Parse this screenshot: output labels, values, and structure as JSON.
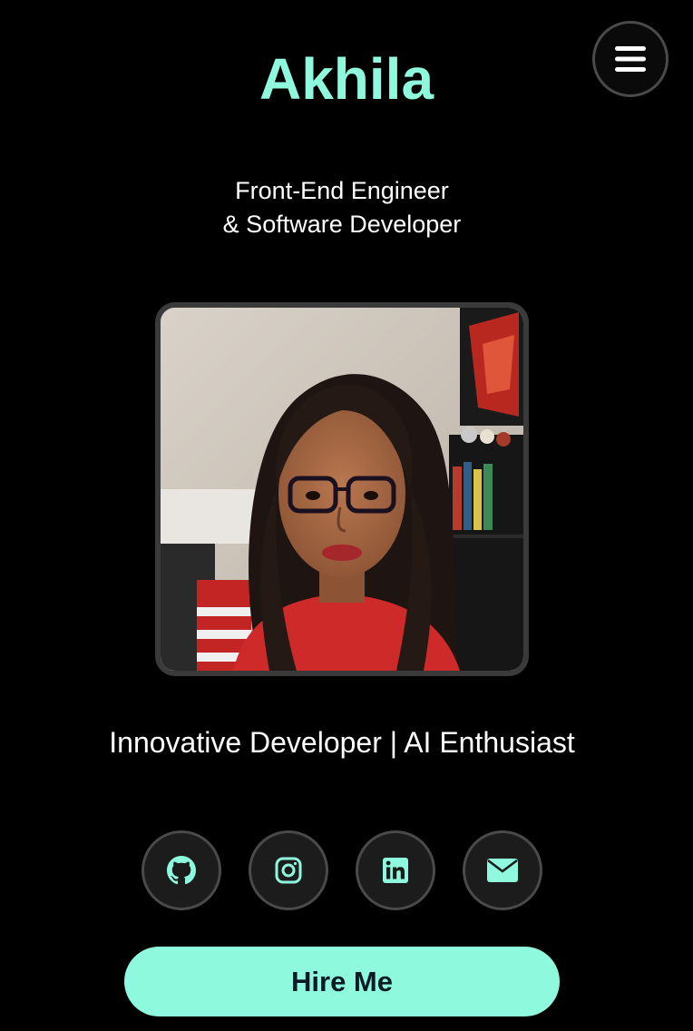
{
  "theme": {
    "accent": "#8ef9dc",
    "background": "#000000",
    "text": "#ffffff",
    "icon_circle_border": "#4a4a4a"
  },
  "header": {
    "name": "Akhila",
    "menu_icon": "hamburger-menu-icon"
  },
  "hero": {
    "subtitle_line1": "Front-End Engineer",
    "subtitle_line2": "& Software Developer",
    "photo_alt": "profile-photo",
    "tagline": "Innovative Developer | AI Enthusiast"
  },
  "social": [
    {
      "icon": "github-icon"
    },
    {
      "icon": "instagram-icon"
    },
    {
      "icon": "linkedin-icon"
    },
    {
      "icon": "email-icon"
    }
  ],
  "cta": {
    "hire_label": "Hire Me"
  }
}
